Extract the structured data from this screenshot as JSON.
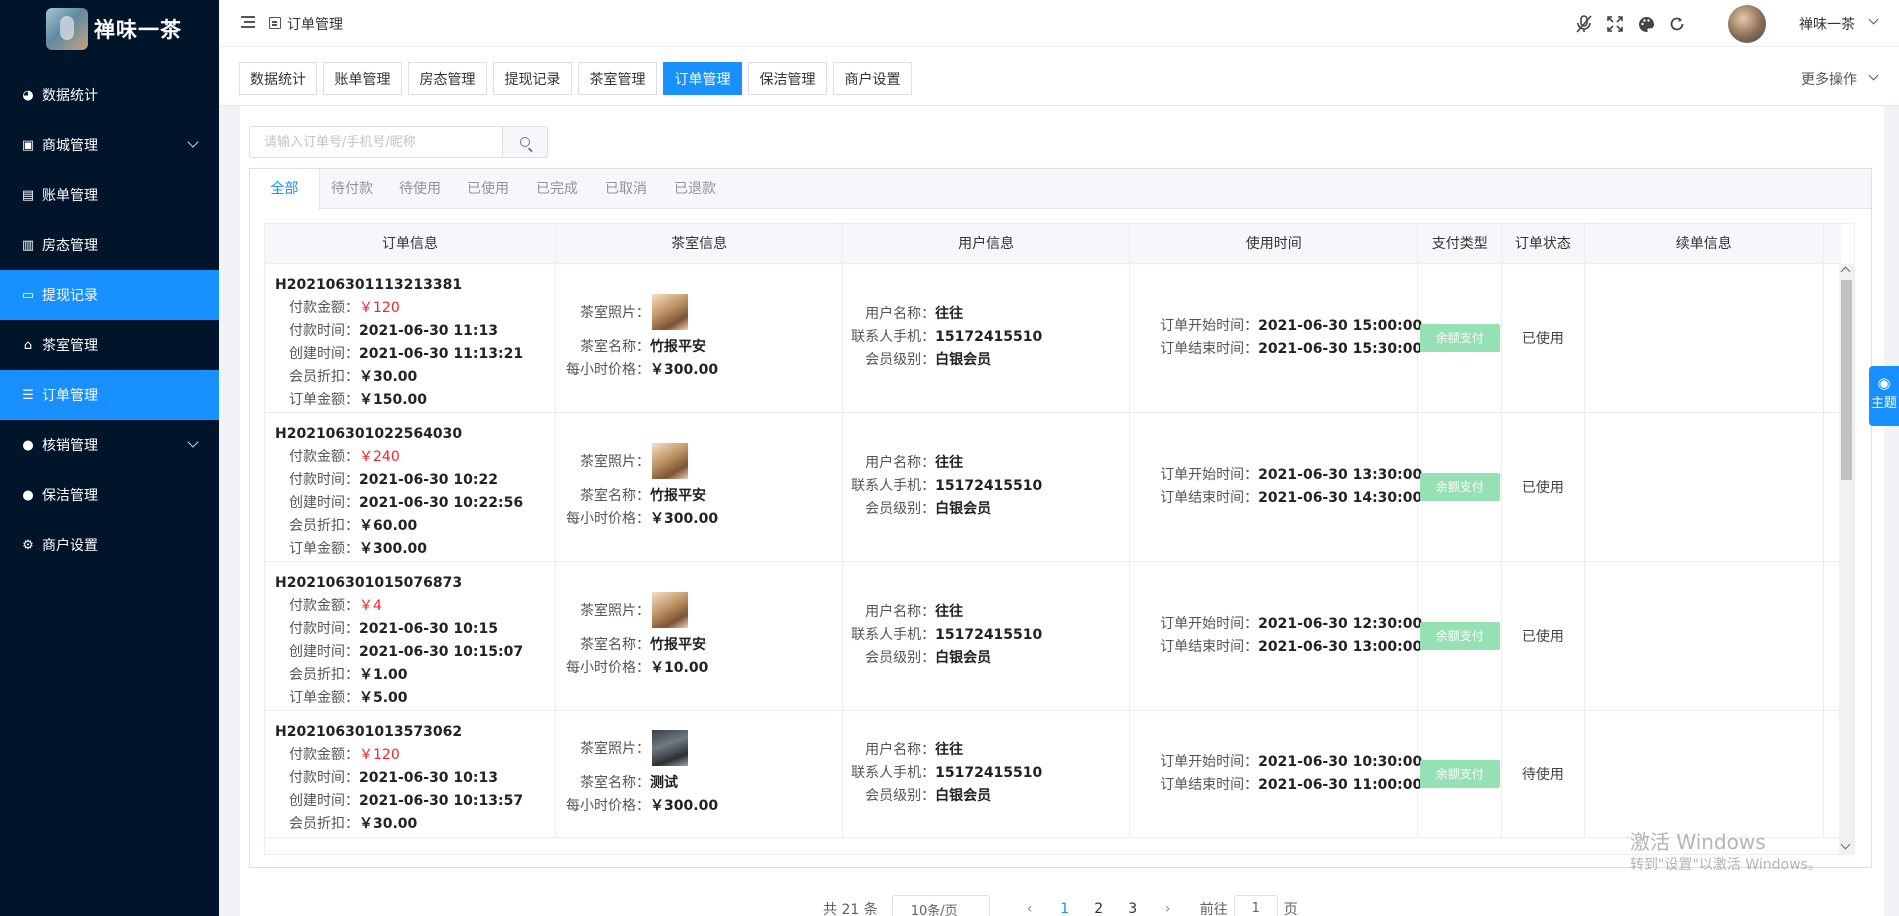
{
  "app": {
    "logo_text": "禅味一茶",
    "username": "禅味一茶",
    "breadcrumb": "订单管理"
  },
  "sidebar": {
    "items": [
      {
        "label": "数据统计",
        "icon": "dashboard-icon",
        "glyph": "◕",
        "active": false,
        "expandable": false
      },
      {
        "label": "商城管理",
        "icon": "shop-icon",
        "glyph": "▣",
        "active": false,
        "expandable": true
      },
      {
        "label": "账单管理",
        "icon": "bill-icon",
        "glyph": "▤",
        "active": false,
        "expandable": false
      },
      {
        "label": "房态管理",
        "icon": "building-icon",
        "glyph": "▥",
        "active": false,
        "expandable": false
      },
      {
        "label": "提现记录",
        "icon": "money-icon",
        "glyph": "▭",
        "active": true,
        "expandable": false
      },
      {
        "label": "茶室管理",
        "icon": "home-icon",
        "glyph": "⌂",
        "active": false,
        "expandable": false
      },
      {
        "label": "订单管理",
        "icon": "list-icon",
        "glyph": "☰",
        "active": true,
        "expandable": false
      },
      {
        "label": "核销管理",
        "icon": "user-check-icon",
        "glyph": "●",
        "active": false,
        "expandable": true
      },
      {
        "label": "保洁管理",
        "icon": "user-icon",
        "glyph": "●",
        "active": false,
        "expandable": false
      },
      {
        "label": "商户设置",
        "icon": "gear-icon",
        "glyph": "⚙",
        "active": false,
        "expandable": false
      }
    ]
  },
  "tabs": {
    "items": [
      "数据统计",
      "账单管理",
      "房态管理",
      "提现记录",
      "茶室管理",
      "订单管理",
      "保洁管理",
      "商户设置"
    ],
    "active_index": 5,
    "more_label": "更多操作"
  },
  "search": {
    "placeholder": "请输入订单号/手机号/昵称",
    "value": ""
  },
  "status_tabs": {
    "items": [
      "全部",
      "待付款",
      "待使用",
      "已使用",
      "已完成",
      "已取消",
      "已退款"
    ],
    "active_index": 0
  },
  "table": {
    "headers": [
      "订单信息",
      "茶室信息",
      "用户信息",
      "使用时间",
      "支付类型",
      "订单状态",
      "续单信息"
    ],
    "labels": {
      "pay_amount": "付款金额：",
      "pay_time": "付款时间：",
      "create_time": "创建时间：",
      "discount": "会员折扣：",
      "order_amount": "订单金额：",
      "room_photo": "茶室照片：",
      "room_name": "茶室名称：",
      "hourly_price": "每小时价格：",
      "user_name": "用户名称：",
      "contact_phone": "联系人手机：",
      "member_level": "会员级别：",
      "start_time": "订单开始时间：",
      "end_time": "订单结束时间："
    },
    "rows": [
      {
        "order_no": "H202106301113213381",
        "pay_amount": "￥120",
        "pay_time": "2021-06-30 11:13",
        "create_time": "2021-06-30 11:13:21",
        "discount": "￥30.00",
        "order_amount": "￥150.00",
        "room_name": "竹报平安",
        "hourly_price": "￥300.00",
        "photo_style": "warm",
        "user_name": "往往",
        "contact_phone": "15172415510",
        "member_level": "白银会员",
        "start_time": "2021-06-30 15:00:00",
        "end_time": "2021-06-30 15:30:00",
        "pay_type": "余额支付",
        "status": "已使用",
        "renewal": ""
      },
      {
        "order_no": "H202106301022564030",
        "pay_amount": "￥240",
        "pay_time": "2021-06-30 10:22",
        "create_time": "2021-06-30 10:22:56",
        "discount": "￥60.00",
        "order_amount": "￥300.00",
        "room_name": "竹报平安",
        "hourly_price": "￥300.00",
        "photo_style": "warm",
        "user_name": "往往",
        "contact_phone": "15172415510",
        "member_level": "白银会员",
        "start_time": "2021-06-30 13:30:00",
        "end_time": "2021-06-30 14:30:00",
        "pay_type": "余额支付",
        "status": "已使用",
        "renewal": ""
      },
      {
        "order_no": "H202106301015076873",
        "pay_amount": "￥4",
        "pay_time": "2021-06-30 10:15",
        "create_time": "2021-06-30 10:15:07",
        "discount": "￥1.00",
        "order_amount": "￥5.00",
        "room_name": "竹报平安",
        "hourly_price": "￥10.00",
        "photo_style": "warm",
        "user_name": "往往",
        "contact_phone": "15172415510",
        "member_level": "白银会员",
        "start_time": "2021-06-30 12:30:00",
        "end_time": "2021-06-30 13:00:00",
        "pay_type": "余额支付",
        "status": "已使用",
        "renewal": ""
      },
      {
        "order_no": "H202106301013573062",
        "pay_amount": "￥120",
        "pay_time": "2021-06-30 10:13",
        "create_time": "2021-06-30 10:13:57",
        "discount": "￥30.00",
        "order_amount": "",
        "room_name": "测试",
        "hourly_price": "￥300.00",
        "photo_style": "dark",
        "user_name": "往往",
        "contact_phone": "15172415510",
        "member_level": "白银会员",
        "start_time": "2021-06-30 10:30:00",
        "end_time": "2021-06-30 11:00:00",
        "pay_type": "余额支付",
        "status": "待使用",
        "renewal": ""
      }
    ]
  },
  "pagination": {
    "total_text": "共 21 条",
    "page_size": "10条/页",
    "pages": [
      "1",
      "2",
      "3"
    ],
    "current": "1",
    "goto_label": "前往",
    "goto_value": "1",
    "page_unit": "页"
  },
  "theme_float": {
    "label": "主题",
    "icon": "palette-icon"
  },
  "watermark": {
    "line1": "激活 Windows",
    "line2": "转到\"设置\"以激活 Windows。"
  },
  "colors": {
    "sidebar_bg": "#001529",
    "accent": "#1890ff",
    "pay_tag": "#95e1b4",
    "amount_red": "#f5222d"
  }
}
